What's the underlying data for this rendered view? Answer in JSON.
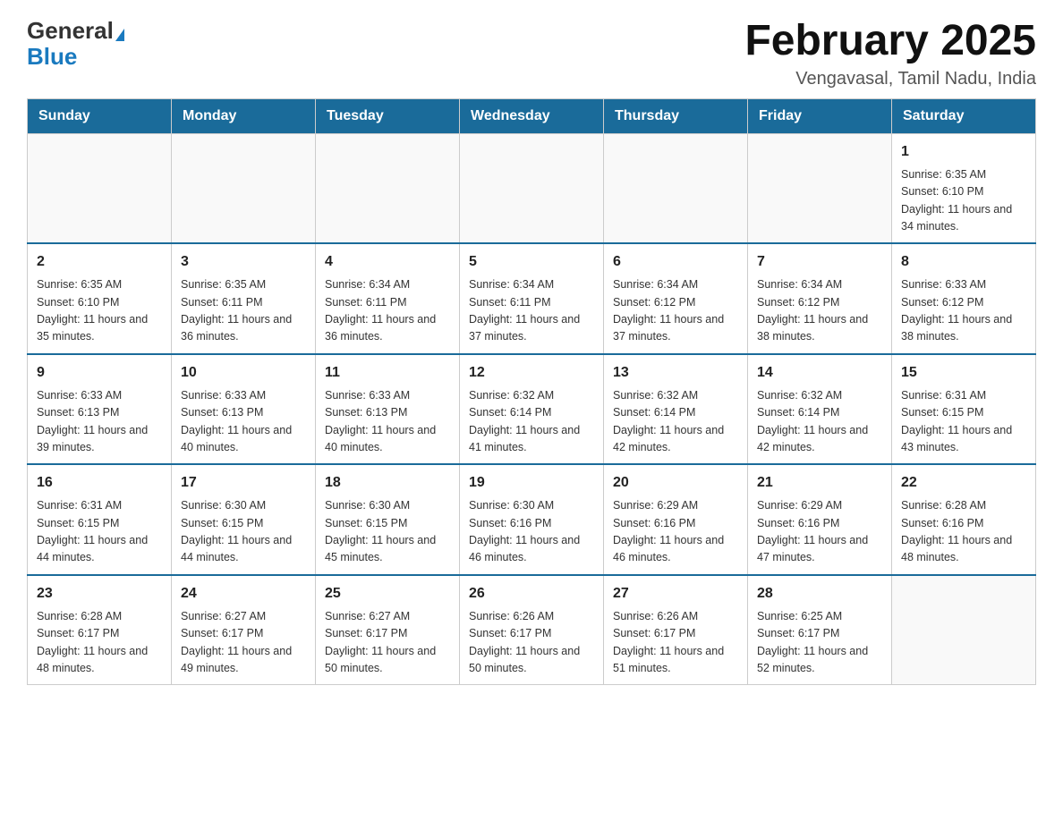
{
  "logo": {
    "general": "General",
    "blue": "Blue",
    "triangle": "▶"
  },
  "title": "February 2025",
  "subtitle": "Vengavasal, Tamil Nadu, India",
  "days_of_week": [
    "Sunday",
    "Monday",
    "Tuesday",
    "Wednesday",
    "Thursday",
    "Friday",
    "Saturday"
  ],
  "weeks": [
    [
      {
        "day": "",
        "info": ""
      },
      {
        "day": "",
        "info": ""
      },
      {
        "day": "",
        "info": ""
      },
      {
        "day": "",
        "info": ""
      },
      {
        "day": "",
        "info": ""
      },
      {
        "day": "",
        "info": ""
      },
      {
        "day": "1",
        "info": "Sunrise: 6:35 AM\nSunset: 6:10 PM\nDaylight: 11 hours and 34 minutes."
      }
    ],
    [
      {
        "day": "2",
        "info": "Sunrise: 6:35 AM\nSunset: 6:10 PM\nDaylight: 11 hours and 35 minutes."
      },
      {
        "day": "3",
        "info": "Sunrise: 6:35 AM\nSunset: 6:11 PM\nDaylight: 11 hours and 36 minutes."
      },
      {
        "day": "4",
        "info": "Sunrise: 6:34 AM\nSunset: 6:11 PM\nDaylight: 11 hours and 36 minutes."
      },
      {
        "day": "5",
        "info": "Sunrise: 6:34 AM\nSunset: 6:11 PM\nDaylight: 11 hours and 37 minutes."
      },
      {
        "day": "6",
        "info": "Sunrise: 6:34 AM\nSunset: 6:12 PM\nDaylight: 11 hours and 37 minutes."
      },
      {
        "day": "7",
        "info": "Sunrise: 6:34 AM\nSunset: 6:12 PM\nDaylight: 11 hours and 38 minutes."
      },
      {
        "day": "8",
        "info": "Sunrise: 6:33 AM\nSunset: 6:12 PM\nDaylight: 11 hours and 38 minutes."
      }
    ],
    [
      {
        "day": "9",
        "info": "Sunrise: 6:33 AM\nSunset: 6:13 PM\nDaylight: 11 hours and 39 minutes."
      },
      {
        "day": "10",
        "info": "Sunrise: 6:33 AM\nSunset: 6:13 PM\nDaylight: 11 hours and 40 minutes."
      },
      {
        "day": "11",
        "info": "Sunrise: 6:33 AM\nSunset: 6:13 PM\nDaylight: 11 hours and 40 minutes."
      },
      {
        "day": "12",
        "info": "Sunrise: 6:32 AM\nSunset: 6:14 PM\nDaylight: 11 hours and 41 minutes."
      },
      {
        "day": "13",
        "info": "Sunrise: 6:32 AM\nSunset: 6:14 PM\nDaylight: 11 hours and 42 minutes."
      },
      {
        "day": "14",
        "info": "Sunrise: 6:32 AM\nSunset: 6:14 PM\nDaylight: 11 hours and 42 minutes."
      },
      {
        "day": "15",
        "info": "Sunrise: 6:31 AM\nSunset: 6:15 PM\nDaylight: 11 hours and 43 minutes."
      }
    ],
    [
      {
        "day": "16",
        "info": "Sunrise: 6:31 AM\nSunset: 6:15 PM\nDaylight: 11 hours and 44 minutes."
      },
      {
        "day": "17",
        "info": "Sunrise: 6:30 AM\nSunset: 6:15 PM\nDaylight: 11 hours and 44 minutes."
      },
      {
        "day": "18",
        "info": "Sunrise: 6:30 AM\nSunset: 6:15 PM\nDaylight: 11 hours and 45 minutes."
      },
      {
        "day": "19",
        "info": "Sunrise: 6:30 AM\nSunset: 6:16 PM\nDaylight: 11 hours and 46 minutes."
      },
      {
        "day": "20",
        "info": "Sunrise: 6:29 AM\nSunset: 6:16 PM\nDaylight: 11 hours and 46 minutes."
      },
      {
        "day": "21",
        "info": "Sunrise: 6:29 AM\nSunset: 6:16 PM\nDaylight: 11 hours and 47 minutes."
      },
      {
        "day": "22",
        "info": "Sunrise: 6:28 AM\nSunset: 6:16 PM\nDaylight: 11 hours and 48 minutes."
      }
    ],
    [
      {
        "day": "23",
        "info": "Sunrise: 6:28 AM\nSunset: 6:17 PM\nDaylight: 11 hours and 48 minutes."
      },
      {
        "day": "24",
        "info": "Sunrise: 6:27 AM\nSunset: 6:17 PM\nDaylight: 11 hours and 49 minutes."
      },
      {
        "day": "25",
        "info": "Sunrise: 6:27 AM\nSunset: 6:17 PM\nDaylight: 11 hours and 50 minutes."
      },
      {
        "day": "26",
        "info": "Sunrise: 6:26 AM\nSunset: 6:17 PM\nDaylight: 11 hours and 50 minutes."
      },
      {
        "day": "27",
        "info": "Sunrise: 6:26 AM\nSunset: 6:17 PM\nDaylight: 11 hours and 51 minutes."
      },
      {
        "day": "28",
        "info": "Sunrise: 6:25 AM\nSunset: 6:17 PM\nDaylight: 11 hours and 52 minutes."
      },
      {
        "day": "",
        "info": ""
      }
    ]
  ]
}
